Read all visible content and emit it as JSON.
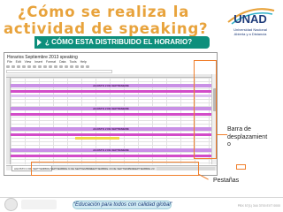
{
  "slide": {
    "title_line1": "¿Cómo se realiza la",
    "title_line2": "actividad de speaking?",
    "banner": "¿ CÓMO ESTA DISTRIBUIDO EL  HORARIO?"
  },
  "logo": {
    "name": "UNAD",
    "line1": "Universidad Nacional",
    "line2": "Abierta y a Distancia",
    "color": "#1f3c7a"
  },
  "spreadsheet": {
    "doc_title": "Horarios Septiembre 2013 speaking",
    "menu": [
      "File",
      "Edit",
      "View",
      "Insert",
      "Format",
      "Data",
      "Tools",
      "Help"
    ],
    "day_band_label": "AGOSTO 2 DE SEPTIEMBRE",
    "tabs": [
      "AGOSTO 2 DE SEPTIEMBRE",
      "SEPTIEMBRE 9 DE SEPTIEMBRE",
      "SEPTIEMBRE 16 DE SEPTIEMBRE",
      "SEPTIEMBRE 23"
    ],
    "colors": {
      "day_band": "#c990e6",
      "magenta_row": "#d24bc8",
      "lavender_row": "#dcc3f0",
      "yellow_cell": "#f3d64a"
    }
  },
  "annotations": {
    "scrollbar_line1": "Barra de",
    "scrollbar_line2": "desplazamient",
    "scrollbar_line3": "o",
    "tabs": "Pestañas",
    "highlight_color": "#f07f2c"
  },
  "footer": {
    "slogan": "“Educación para todos con calidad global”",
    "contact": "PBX 57(1) 344 3700 EXT 0000"
  },
  "accent_colors": {
    "title": "#e8a33c",
    "banner": "#0d8f7c"
  }
}
